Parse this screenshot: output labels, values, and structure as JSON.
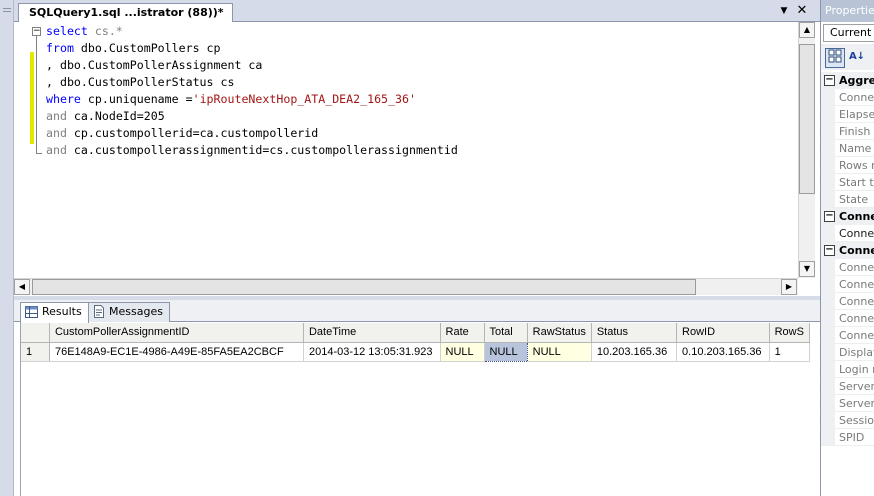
{
  "editor": {
    "tab_title": "SQLQuery1.sql ...istrator (88))*",
    "tab_dropdown_icon": "▼",
    "tab_close_icon": "✕",
    "code": [
      [
        {
          "t": "select",
          "c": "kw"
        },
        {
          "t": " cs.*",
          "c": "gr"
        }
      ],
      [
        {
          "t": "from",
          "c": "kw"
        },
        {
          "t": " dbo.CustomPollers cp",
          "c": "tx"
        }
      ],
      [
        {
          "t": ", dbo.CustomPollerAssignment ca",
          "c": "tx"
        }
      ],
      [
        {
          "t": ", dbo.CustomPollerStatus cs",
          "c": "tx"
        }
      ],
      [
        {
          "t": "where",
          "c": "kw"
        },
        {
          "t": " cp.uniquename =",
          "c": "tx"
        },
        {
          "t": "'ipRouteNextHop_ATA_DEA2_165_36'",
          "c": "st"
        }
      ],
      [
        {
          "t": "and",
          "c": "gr"
        },
        {
          "t": " ca.NodeId=205",
          "c": "tx"
        }
      ],
      [
        {
          "t": "and",
          "c": "gr"
        },
        {
          "t": " cp.custompollerid=ca.custompollerid",
          "c": "tx"
        }
      ],
      [
        {
          "t": "and",
          "c": "gr"
        },
        {
          "t": " ca.custompollerassignmentid=cs.custompollerassignmentid",
          "c": "tx"
        }
      ]
    ]
  },
  "results": {
    "tabs": [
      {
        "label": "Results",
        "icon": "grid-icon"
      },
      {
        "label": "Messages",
        "icon": "messages-icon"
      }
    ],
    "columns": [
      "CustomPollerAssignmentID",
      "DateTime",
      "Rate",
      "Total",
      "RawStatus",
      "Status",
      "RowID",
      "RowS"
    ],
    "rows": [
      {
        "num": "1",
        "cells": [
          "76E148A9-EC1E-4986-A49E-85FA5EA2CBCF",
          "2014-03-12 13:05:31.923",
          "NULL",
          "NULL",
          "NULL",
          "10.203.165.36",
          "0.10.203.165.36",
          "1"
        ]
      }
    ]
  },
  "properties": {
    "title": "Properties",
    "combo": "Current c",
    "sections": [
      {
        "label": "Aggre",
        "expanded": true,
        "items": [
          {
            "label": "Connec",
            "dark": false
          },
          {
            "label": "Elapsed",
            "dark": false
          },
          {
            "label": "Finish t",
            "dark": false
          },
          {
            "label": "Name",
            "dark": false
          },
          {
            "label": "Rows re",
            "dark": false
          },
          {
            "label": "Start ti",
            "dark": false
          },
          {
            "label": "State",
            "dark": false
          }
        ]
      },
      {
        "label": "Conne",
        "expanded": true,
        "items": [
          {
            "label": "Connec",
            "dark": true
          }
        ]
      },
      {
        "label": "Conne",
        "expanded": true,
        "items": [
          {
            "label": "Connec",
            "dark": false
          },
          {
            "label": "Connec",
            "dark": false
          },
          {
            "label": "Connec",
            "dark": false
          },
          {
            "label": "Connec",
            "dark": false
          },
          {
            "label": "Connec",
            "dark": false
          },
          {
            "label": "Display",
            "dark": false
          },
          {
            "label": "Login n",
            "dark": false
          },
          {
            "label": "Server",
            "dark": false
          },
          {
            "label": "Server",
            "dark": false
          },
          {
            "label": "Session",
            "dark": false
          },
          {
            "label": "SPID",
            "dark": false
          }
        ]
      }
    ]
  }
}
